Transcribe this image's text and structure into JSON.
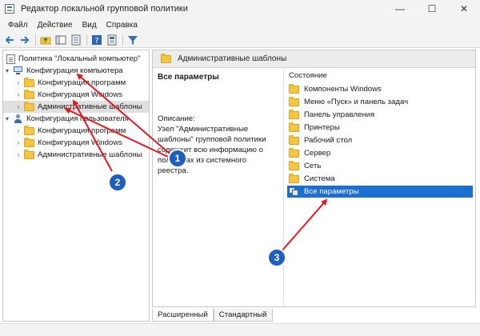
{
  "window": {
    "title": "Редактор локальной групповой политики",
    "minimize_glyph": "—",
    "maximize_glyph": "☐",
    "close_glyph": "✕"
  },
  "menu": [
    "Файл",
    "Действие",
    "Вид",
    "Справка"
  ],
  "toolbar": {
    "icons": [
      "back-arrow-icon",
      "forward-arrow-icon",
      "up-folder-icon",
      "show-tree-icon",
      "export-list-icon",
      "help-icon",
      "properties-icon",
      "filter-icon"
    ]
  },
  "tree": {
    "root": "Политика \"Локальный компьютер\"",
    "computer_config": "Конфигурация компьютера",
    "computer_children": [
      "Конфигурация программ",
      "Конфигурация Windows",
      "Административные шаблоны"
    ],
    "user_config": "Конфигурация пользователя",
    "user_children": [
      "Конфигурация программ",
      "Конфигурация Windows",
      "Административные шаблоны"
    ]
  },
  "right_pane": {
    "header": "Административные шаблоны",
    "selected_title": "Все параметры",
    "description_label": "Описание:",
    "description_text": "Узел \"Административные шаблоны\" групповой политики содержит всю информацию о политиках из системного реестра.",
    "column_header": "Состояние",
    "items": [
      "Компоненты Windows",
      "Меню «Пуск» и панель задач",
      "Панель управления",
      "Принтеры",
      "Рабочий стол",
      "Сервер",
      "Сеть",
      "Система"
    ],
    "all_settings": "Все параметры"
  },
  "tabs": [
    "Расширенный",
    "Стандартный"
  ],
  "annotations": {
    "color": "#e01b24",
    "badge_color": "#1f5fbf",
    "labels": [
      "1",
      "2",
      "3"
    ]
  }
}
